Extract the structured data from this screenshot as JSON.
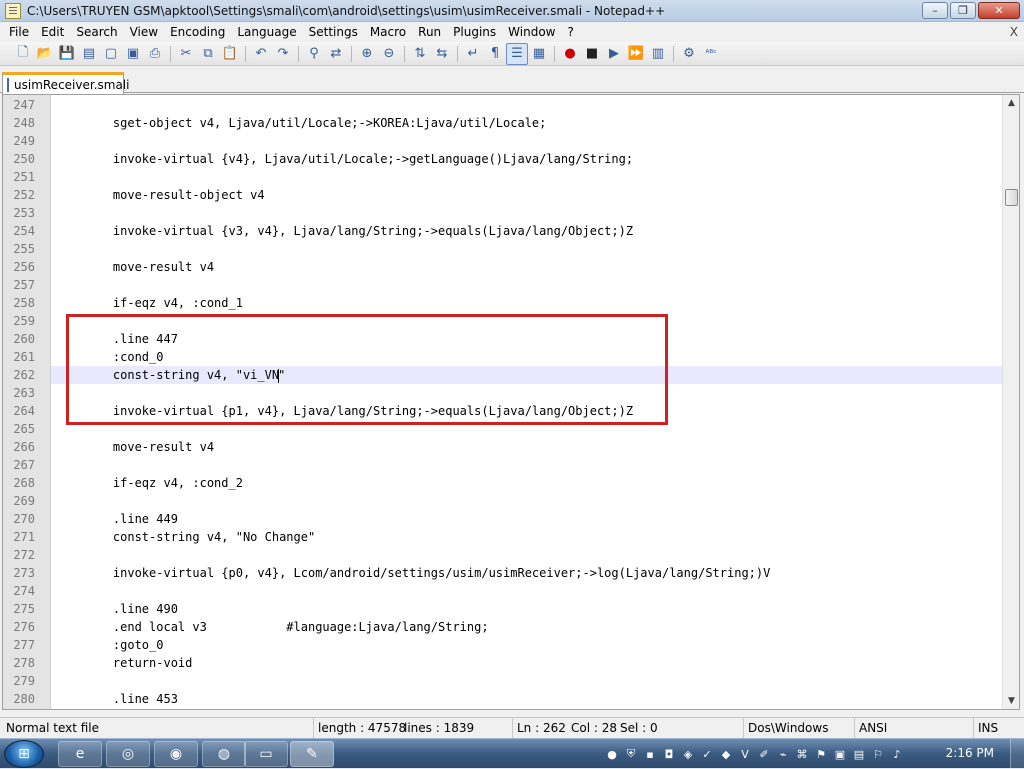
{
  "window": {
    "title": "C:\\Users\\TRUYEN GSM\\apktool\\Settings\\smali\\com\\android\\settings\\usim\\usimReceiver.smali - Notepad++",
    "controls": {
      "minimize": "–",
      "maximize": "❐",
      "close": "✕"
    }
  },
  "menu": {
    "items": [
      "File",
      "Edit",
      "Search",
      "View",
      "Encoding",
      "Language",
      "Settings",
      "Macro",
      "Run",
      "Plugins",
      "Window",
      "?"
    ],
    "close_doc": "X"
  },
  "toolbar": {
    "icons": [
      "new-file-icon",
      "open-file-icon",
      "save-icon",
      "save-all-icon",
      "close-icon",
      "close-all-icon",
      "print-icon",
      "cut-icon",
      "copy-icon",
      "paste-icon",
      "undo-icon",
      "redo-icon",
      "find-icon",
      "replace-icon",
      "zoom-in-icon",
      "zoom-out-icon",
      "sync-vertical-icon",
      "sync-horizontal-icon",
      "word-wrap-icon",
      "show-all-chars-icon",
      "indent-guide-icon",
      "doc-map-icon",
      "record-macro-icon",
      "stop-macro-icon",
      "play-macro-icon",
      "run-macro-multiple-icon",
      "save-macro-icon",
      "launch-icon",
      "spell-check-icon"
    ]
  },
  "tabs": [
    {
      "label": "usimReceiver.smali",
      "active": true
    }
  ],
  "editor": {
    "current_line": 262,
    "lines": [
      {
        "num": "247",
        "text": ""
      },
      {
        "num": "248",
        "text": "    sget-object v4, Ljava/util/Locale;->KOREA:Ljava/util/Locale;"
      },
      {
        "num": "249",
        "text": ""
      },
      {
        "num": "250",
        "text": "    invoke-virtual {v4}, Ljava/util/Locale;->getLanguage()Ljava/lang/String;"
      },
      {
        "num": "251",
        "text": ""
      },
      {
        "num": "252",
        "text": "    move-result-object v4"
      },
      {
        "num": "253",
        "text": ""
      },
      {
        "num": "254",
        "text": "    invoke-virtual {v3, v4}, Ljava/lang/String;->equals(Ljava/lang/Object;)Z"
      },
      {
        "num": "255",
        "text": ""
      },
      {
        "num": "256",
        "text": "    move-result v4"
      },
      {
        "num": "257",
        "text": ""
      },
      {
        "num": "258",
        "text": "    if-eqz v4, :cond_1"
      },
      {
        "num": "259",
        "text": ""
      },
      {
        "num": "260",
        "text": "    .line 447"
      },
      {
        "num": "261",
        "text": "    :cond_0"
      },
      {
        "num": "262",
        "text": "    const-string v4, \"vi_VN\""
      },
      {
        "num": "263",
        "text": ""
      },
      {
        "num": "264",
        "text": "    invoke-virtual {p1, v4}, Ljava/lang/String;->equals(Ljava/lang/Object;)Z"
      },
      {
        "num": "265",
        "text": ""
      },
      {
        "num": "266",
        "text": "    move-result v4"
      },
      {
        "num": "267",
        "text": ""
      },
      {
        "num": "268",
        "text": "    if-eqz v4, :cond_2"
      },
      {
        "num": "269",
        "text": ""
      },
      {
        "num": "270",
        "text": "    .line 449"
      },
      {
        "num": "271",
        "text": "    const-string v4, \"No Change\""
      },
      {
        "num": "272",
        "text": ""
      },
      {
        "num": "273",
        "text": "    invoke-virtual {p0, v4}, Lcom/android/settings/usim/usimReceiver;->log(Ljava/lang/String;)V"
      },
      {
        "num": "274",
        "text": ""
      },
      {
        "num": "275",
        "text": "    .line 490"
      },
      {
        "num": "276",
        "text": "    .end local v3           #language:Ljava/lang/String;"
      },
      {
        "num": "277",
        "text": "    :goto_0"
      },
      {
        "num": "278",
        "text": "    return-void"
      },
      {
        "num": "279",
        "text": ""
      },
      {
        "num": "280",
        "text": "    .line 453"
      }
    ]
  },
  "statusbar": {
    "file_type": "Normal text file",
    "length": "length : 47578",
    "lines": "lines : 1839",
    "ln": "Ln : 262",
    "col": "Col : 28",
    "sel": "Sel : 0",
    "eol": "Dos\\Windows",
    "encoding": "ANSI",
    "mode": "INS"
  },
  "taskbar": {
    "start": "⊞",
    "apps": [
      "internet-explorer-icon",
      "chrome-icon",
      "firefox-icon",
      "opera-icon",
      "file-explorer-icon",
      "notepadpp-icon"
    ],
    "clock": "2:16 PM"
  },
  "colors": {
    "highlight_box": "#cc2222",
    "current_line_bg": "#e8e8ff",
    "tab_accent": "#f5a623"
  }
}
